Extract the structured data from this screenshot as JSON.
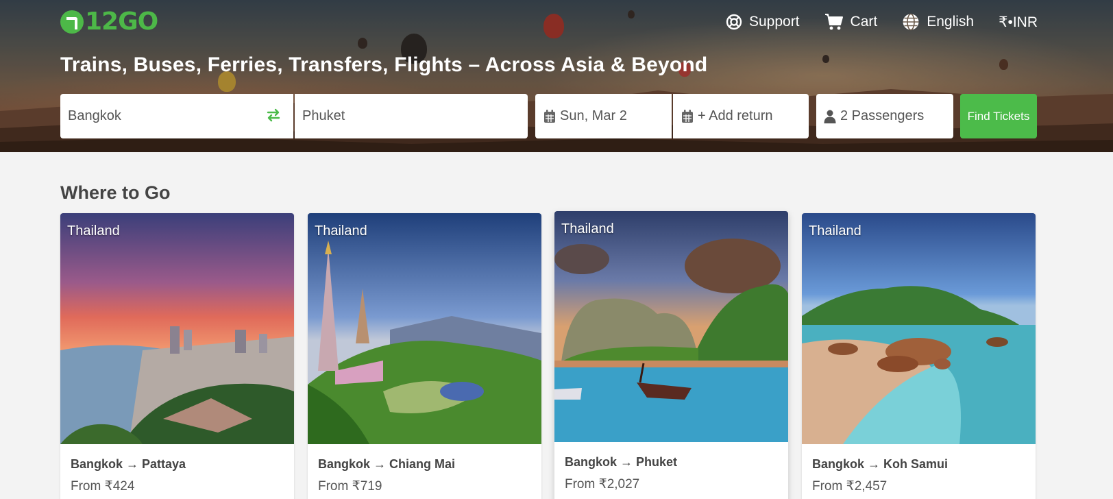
{
  "brand": {
    "logo_text": "12GO",
    "accent": "#4cbb4a"
  },
  "nav": {
    "support": "Support",
    "cart": "Cart",
    "language": "English",
    "currency": "₹•INR"
  },
  "hero": {
    "headline": "Trains, Buses, Ferries, Transfers, Flights – Across Asia & Beyond"
  },
  "search": {
    "from": "Bangkok",
    "to": "Phuket",
    "date": "Sun, Mar 2",
    "return": "+ Add return",
    "passengers": "2 Passengers",
    "submit": "Find Tickets"
  },
  "destinations": {
    "title": "Where to Go",
    "cards": [
      {
        "country": "Thailand",
        "route": "Bangkok → Pattaya",
        "price": "From ₹424"
      },
      {
        "country": "Thailand",
        "route": "Bangkok → Chiang Mai",
        "price": "From ₹719"
      },
      {
        "country": "Thailand",
        "route": "Bangkok → Phuket",
        "price": "From ₹2,027"
      },
      {
        "country": "Thailand",
        "route": "Bangkok → Koh Samui",
        "price": "From ₹2,457"
      }
    ]
  }
}
